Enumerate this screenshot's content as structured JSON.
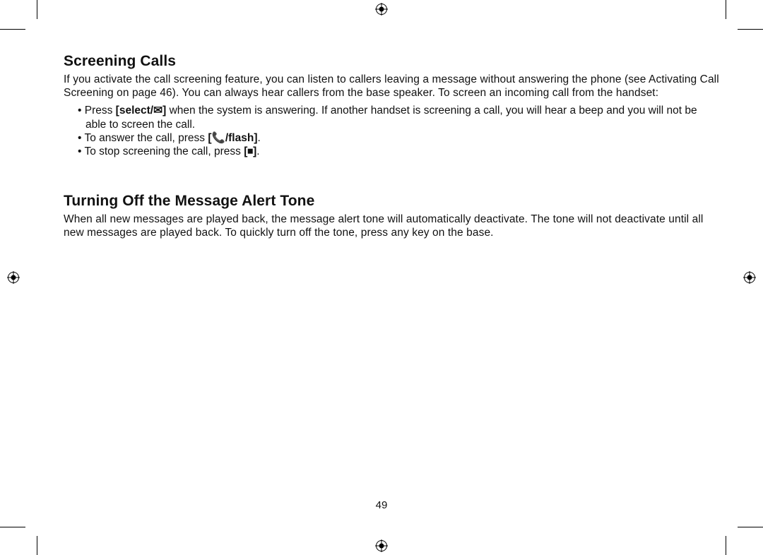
{
  "page_number": "49",
  "section1": {
    "heading": "Screening Calls",
    "intro": "If you activate the call screening feature, you can listen to callers leaving a message without answering the phone (see Activating Call Screening on page 46). You can always hear callers from the base speaker. To screen an incoming call from the handset:",
    "bullet1_pre": "Press ",
    "bullet1_key_open": "select/",
    "bullet1_post": " when the system is answering. If another handset is screening a call, you will hear a beep and you will not be able to screen the call.",
    "bullet2_pre": "To answer the call, press ",
    "bullet2_key": "/flash",
    "bullet2_post": ".",
    "bullet3_pre": "To stop screening the call, press ",
    "bullet3_post": "."
  },
  "section2": {
    "heading": "Turning Off the Message Alert Tone",
    "body": "When all new messages are played back, the message alert tone will automatically deactivate. The tone will not deactivate until all new messages are played back. To quickly turn off the tone, press any key on the base."
  }
}
